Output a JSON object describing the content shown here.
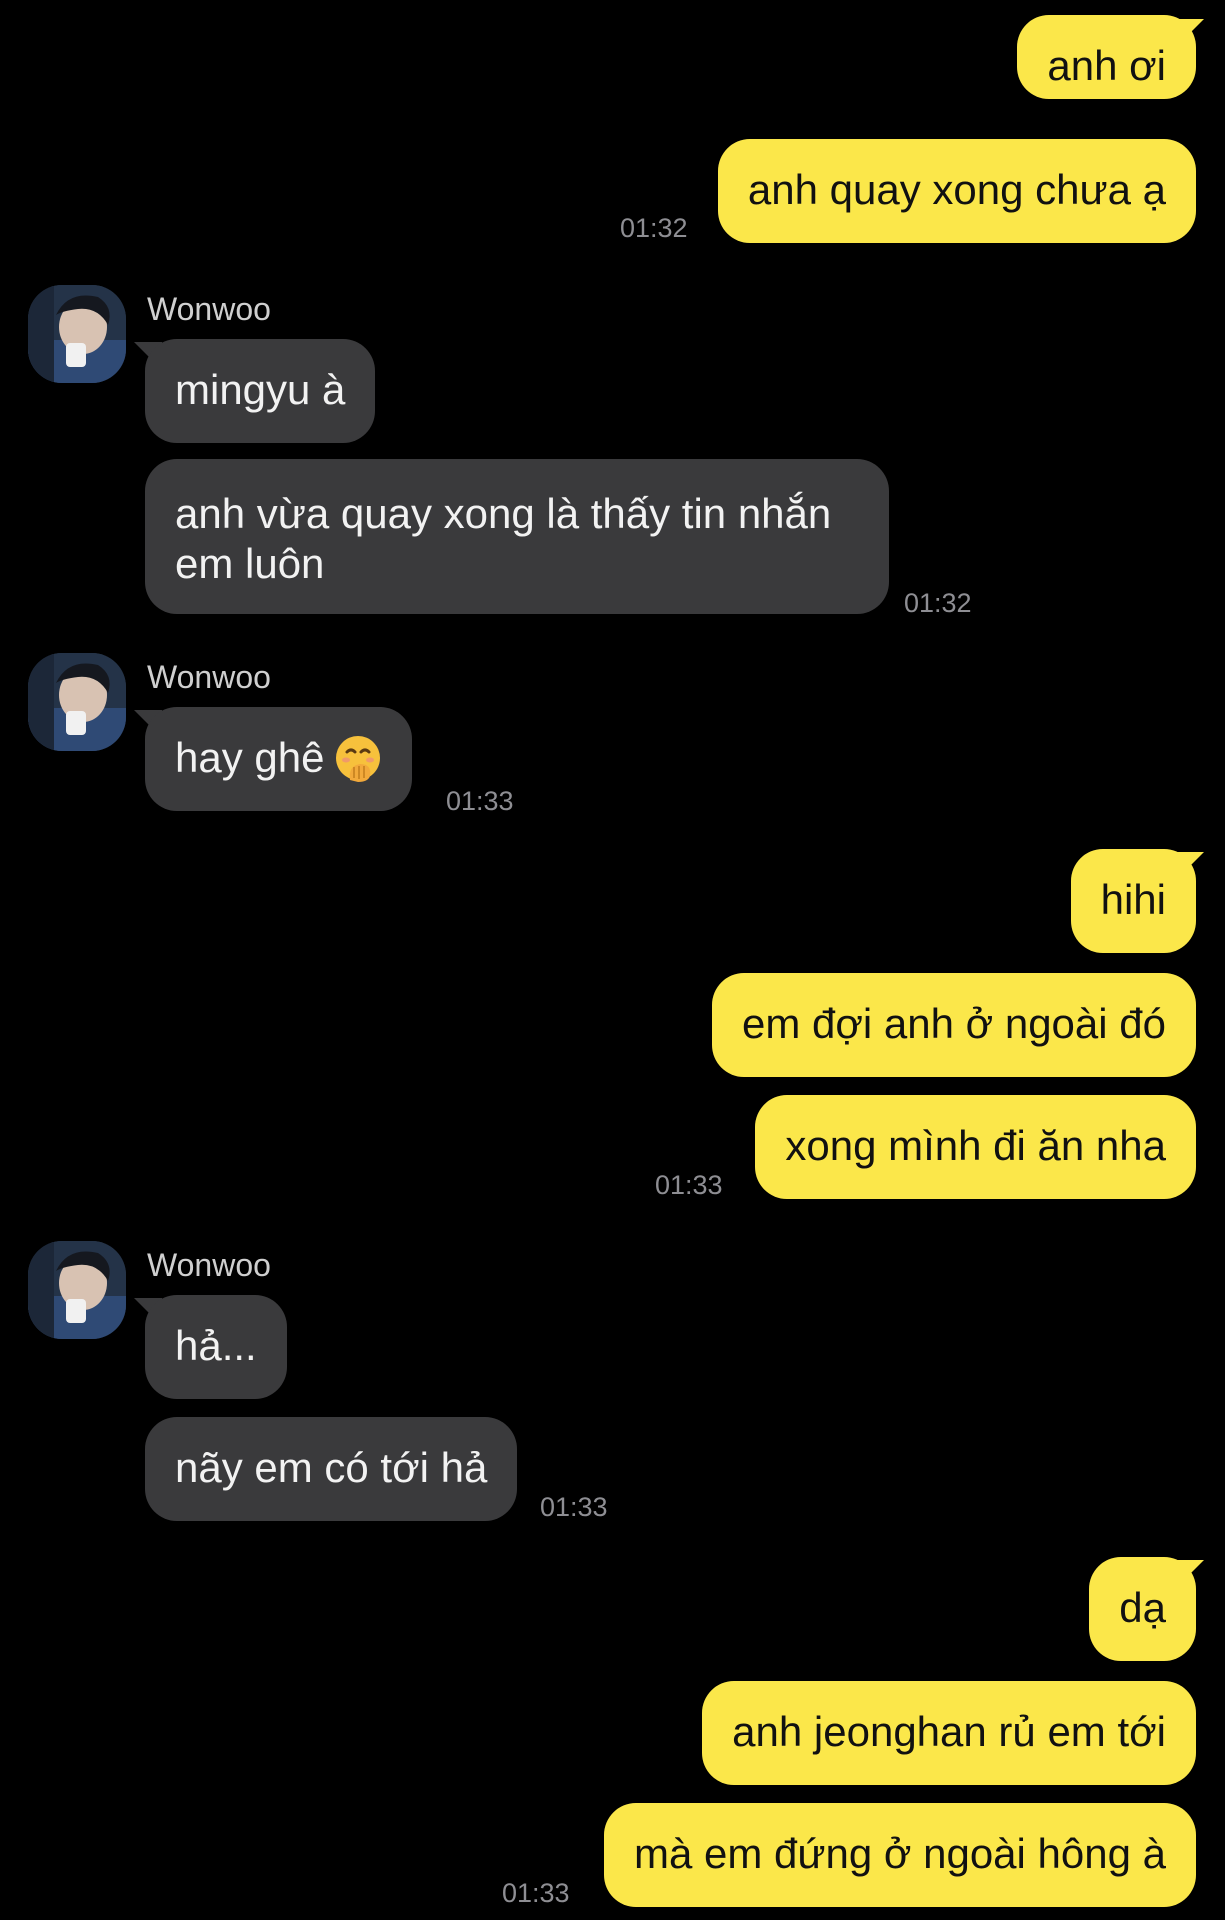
{
  "chat": {
    "contact_name": "Wonwoo",
    "colors": {
      "background": "#000000",
      "outgoing_bubble": "#FBE74A",
      "incoming_bubble": "#3A3A3C",
      "timestamp": "#8E8E93"
    },
    "messages": [
      {
        "text": "anh ơi",
        "direction": "out"
      },
      {
        "text": "anh quay xong chưa ạ",
        "direction": "out",
        "time": "01:32"
      },
      {
        "sender": "Wonwoo",
        "text": "mingyu à",
        "direction": "in"
      },
      {
        "text": "anh vừa quay xong là thấy tin nhắn em luôn",
        "direction": "in",
        "time": "01:32"
      },
      {
        "sender": "Wonwoo",
        "text": "hay ghê",
        "emoji": "face-with-hand-over-mouth-emoji",
        "direction": "in",
        "time": "01:33"
      },
      {
        "text": "hihi",
        "direction": "out"
      },
      {
        "text": "em đợi anh ở ngoài đó",
        "direction": "out"
      },
      {
        "text": "xong mình đi ăn nha",
        "direction": "out",
        "time": "01:33"
      },
      {
        "sender": "Wonwoo",
        "text": "hả...",
        "direction": "in"
      },
      {
        "text": "nãy em có tới hả",
        "direction": "in",
        "time": "01:33"
      },
      {
        "text": "dạ",
        "direction": "out"
      },
      {
        "text": "anh jeonghan rủ em tới",
        "direction": "out"
      },
      {
        "text": "mà em đứng ở ngoài hông à",
        "direction": "out",
        "time": "01:33"
      }
    ]
  }
}
